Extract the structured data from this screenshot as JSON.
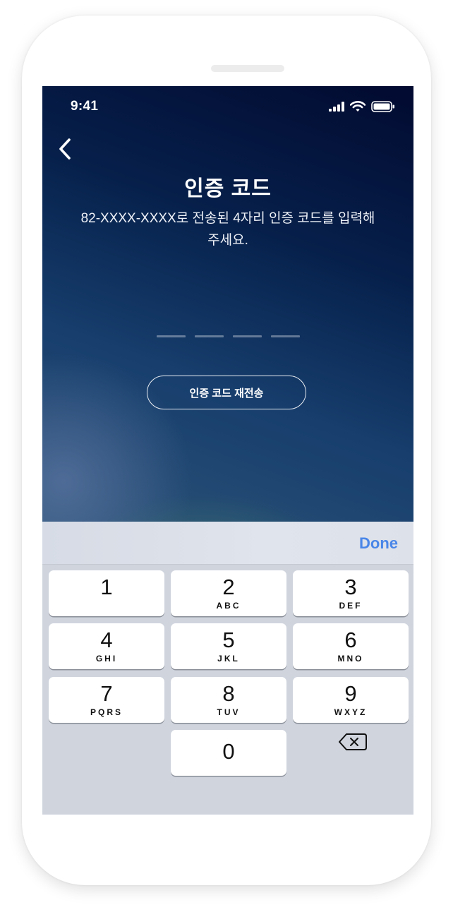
{
  "status": {
    "time": "9:41"
  },
  "header": {
    "title": "인증 코드",
    "subtitle": "82-XXXX-XXXX로 전송된 4자리 인증 코드를 입력해 주세요."
  },
  "code": {
    "length": 4,
    "entered": ""
  },
  "resend_label": "인증 코드 재전송",
  "keyboard": {
    "done_label": "Done",
    "keys": [
      {
        "digit": "1",
        "letters": ""
      },
      {
        "digit": "2",
        "letters": "ABC"
      },
      {
        "digit": "3",
        "letters": "DEF"
      },
      {
        "digit": "4",
        "letters": "GHI"
      },
      {
        "digit": "5",
        "letters": "JKL"
      },
      {
        "digit": "6",
        "letters": "MNO"
      },
      {
        "digit": "7",
        "letters": "PQRS"
      },
      {
        "digit": "8",
        "letters": "TUV"
      },
      {
        "digit": "9",
        "letters": "WXYZ"
      },
      {
        "digit": "0",
        "letters": ""
      }
    ]
  },
  "colors": {
    "accent": "#4a86e8",
    "keyboard_bg": "#cfd4dd",
    "key_bg": "#ffffff"
  },
  "icons": [
    "back-chevron-icon",
    "signal-bars-icon",
    "wifi-icon",
    "battery-icon",
    "backspace-icon"
  ]
}
